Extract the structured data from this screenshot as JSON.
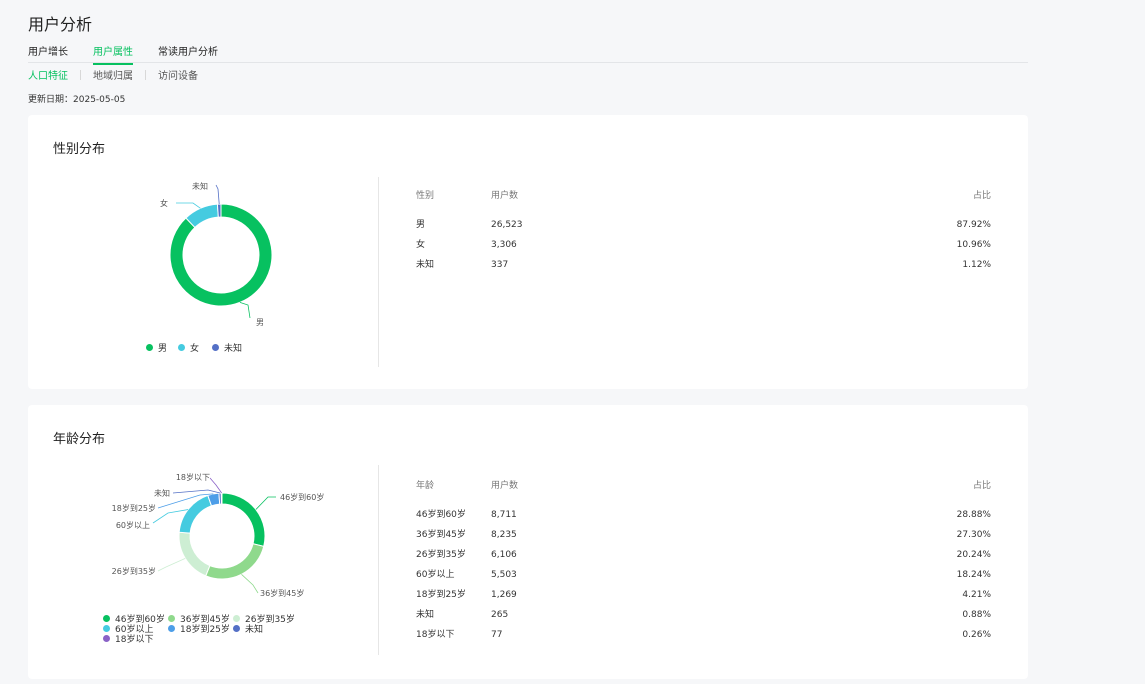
{
  "page": {
    "title": "用户分析"
  },
  "tabs": [
    {
      "label": "用户增长",
      "active": false
    },
    {
      "label": "用户属性",
      "active": true
    },
    {
      "label": "常读用户分析",
      "active": false
    }
  ],
  "subtabs": [
    {
      "label": "人口特征",
      "active": true
    },
    {
      "label": "地域归属",
      "active": false
    },
    {
      "label": "访问设备",
      "active": false
    }
  ],
  "update": {
    "label": "更新日期：",
    "date": "2025-05-05"
  },
  "gender": {
    "title": "性别分布",
    "headers": {
      "col1": "性别",
      "col2": "用户数",
      "col3": "占比"
    },
    "rows": [
      {
        "name": "男",
        "users": "26,523",
        "pct": "87.92%"
      },
      {
        "name": "女",
        "users": "3,306",
        "pct": "10.96%"
      },
      {
        "name": "未知",
        "users": "337",
        "pct": "1.12%"
      }
    ],
    "legend": [
      "男",
      "女",
      "未知"
    ]
  },
  "age": {
    "title": "年龄分布",
    "headers": {
      "col1": "年龄",
      "col2": "用户数",
      "col3": "占比"
    },
    "rows": [
      {
        "name": "46岁到60岁",
        "users": "8,711",
        "pct": "28.88%"
      },
      {
        "name": "36岁到45岁",
        "users": "8,235",
        "pct": "27.30%"
      },
      {
        "name": "26岁到35岁",
        "users": "6,106",
        "pct": "20.24%"
      },
      {
        "name": "60岁以上",
        "users": "5,503",
        "pct": "18.24%"
      },
      {
        "name": "18岁到25岁",
        "users": "1,269",
        "pct": "4.21%"
      },
      {
        "name": "未知",
        "users": "265",
        "pct": "0.88%"
      },
      {
        "name": "18岁以下",
        "users": "77",
        "pct": "0.26%"
      }
    ],
    "legend": [
      "46岁到60岁",
      "36岁到45岁",
      "26岁到35岁",
      "60岁以上",
      "18岁到25岁",
      "未知",
      "18岁以下"
    ]
  },
  "colors": {
    "accent": "#07c160",
    "gender": [
      "#07c160",
      "#45cbe0",
      "#5470c6"
    ],
    "age": [
      "#07c160",
      "#8fd98c",
      "#cdeed3",
      "#45cbe0",
      "#4d9ee8",
      "#5470c6",
      "#8a62c7"
    ]
  },
  "chart_data": [
    {
      "type": "pie",
      "title": "性别分布",
      "categories": [
        "男",
        "女",
        "未知"
      ],
      "values": [
        87.92,
        10.96,
        1.12
      ],
      "legend": "bottom"
    },
    {
      "type": "pie",
      "title": "年龄分布",
      "categories": [
        "46岁到60岁",
        "36岁到45岁",
        "26岁到35岁",
        "60岁以上",
        "18岁到25岁",
        "未知",
        "18岁以下"
      ],
      "values": [
        28.88,
        27.3,
        20.24,
        18.24,
        4.21,
        0.88,
        0.26
      ],
      "legend": "bottom"
    }
  ]
}
